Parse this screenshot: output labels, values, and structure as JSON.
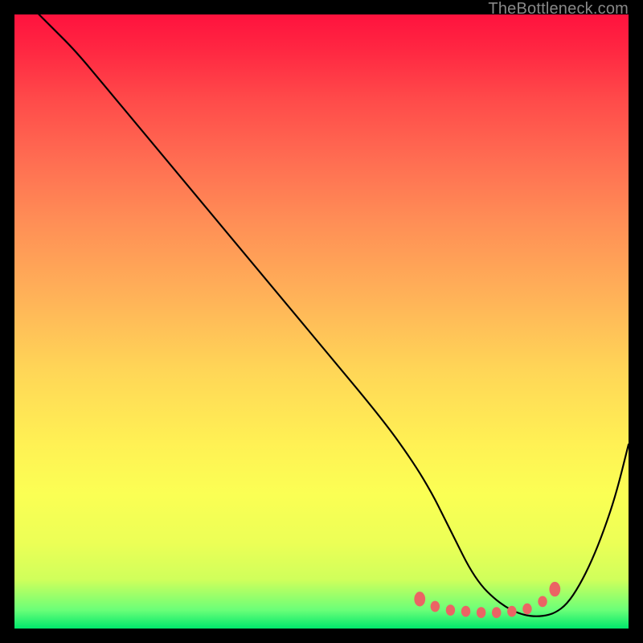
{
  "watermark": "TheBottleneck.com",
  "chart_data": {
    "type": "line",
    "title": "",
    "xlabel": "",
    "ylabel": "",
    "xlim": [
      0,
      100
    ],
    "ylim": [
      0,
      100
    ],
    "series": [
      {
        "name": "curve",
        "x": [
          0,
          3,
          6,
          10,
          15,
          20,
          30,
          40,
          50,
          60,
          65,
          68,
          70,
          72,
          74,
          76,
          78,
          80,
          82,
          84,
          86,
          88,
          90,
          92,
          94,
          96,
          98,
          100
        ],
        "y": [
          104,
          101,
          98,
          94,
          88,
          82,
          70,
          58,
          46,
          34,
          27,
          22,
          18,
          14,
          10,
          7,
          5,
          3.5,
          2.5,
          2,
          2,
          2.5,
          4,
          7,
          11,
          16,
          22,
          30
        ]
      }
    ],
    "markers": {
      "name": "bottom-dots",
      "x": [
        66,
        68.5,
        71,
        73.5,
        76,
        78.5,
        81,
        83.5,
        86,
        88
      ],
      "y": [
        4.8,
        3.6,
        3.0,
        2.8,
        2.6,
        2.6,
        2.8,
        3.2,
        4.4,
        6.4
      ]
    },
    "colors": {
      "curve": "#000000",
      "markers": "#eb6464"
    }
  }
}
